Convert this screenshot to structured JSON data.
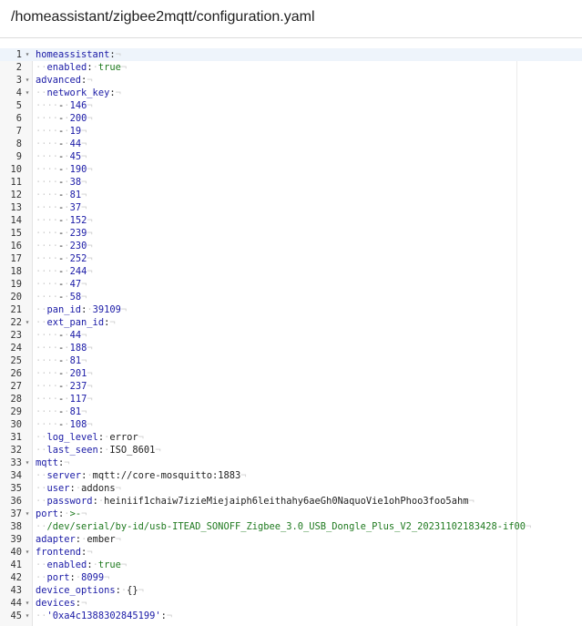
{
  "header": {
    "path": "/homeassistant/zigbee2mqtt/configuration.yaml"
  },
  "editor": {
    "lines": [
      {
        "n": "1",
        "fold": true,
        "indent": "",
        "dash": false,
        "key": "homeassistant",
        "colon": ":",
        "value": "",
        "vtype": "v"
      },
      {
        "n": "2",
        "fold": false,
        "indent": "··",
        "dash": false,
        "key": "enabled",
        "colon": ":",
        "value": "true",
        "vtype": "n"
      },
      {
        "n": "3",
        "fold": true,
        "indent": "",
        "dash": false,
        "key": "advanced",
        "colon": ":",
        "value": "",
        "vtype": "v"
      },
      {
        "n": "4",
        "fold": true,
        "indent": "··",
        "dash": false,
        "key": "network_key",
        "colon": ":",
        "value": "",
        "vtype": "v"
      },
      {
        "n": "5",
        "fold": false,
        "indent": "····",
        "dash": true,
        "key": "",
        "colon": "",
        "value": "146",
        "vtype": "d"
      },
      {
        "n": "6",
        "fold": false,
        "indent": "····",
        "dash": true,
        "key": "",
        "colon": "",
        "value": "200",
        "vtype": "d"
      },
      {
        "n": "7",
        "fold": false,
        "indent": "····",
        "dash": true,
        "key": "",
        "colon": "",
        "value": "19",
        "vtype": "d"
      },
      {
        "n": "8",
        "fold": false,
        "indent": "····",
        "dash": true,
        "key": "",
        "colon": "",
        "value": "44",
        "vtype": "d"
      },
      {
        "n": "9",
        "fold": false,
        "indent": "····",
        "dash": true,
        "key": "",
        "colon": "",
        "value": "45",
        "vtype": "d"
      },
      {
        "n": "10",
        "fold": false,
        "indent": "····",
        "dash": true,
        "key": "",
        "colon": "",
        "value": "190",
        "vtype": "d"
      },
      {
        "n": "11",
        "fold": false,
        "indent": "····",
        "dash": true,
        "key": "",
        "colon": "",
        "value": "38",
        "vtype": "d"
      },
      {
        "n": "12",
        "fold": false,
        "indent": "····",
        "dash": true,
        "key": "",
        "colon": "",
        "value": "81",
        "vtype": "d"
      },
      {
        "n": "13",
        "fold": false,
        "indent": "····",
        "dash": true,
        "key": "",
        "colon": "",
        "value": "37",
        "vtype": "d"
      },
      {
        "n": "14",
        "fold": false,
        "indent": "····",
        "dash": true,
        "key": "",
        "colon": "",
        "value": "152",
        "vtype": "d"
      },
      {
        "n": "15",
        "fold": false,
        "indent": "····",
        "dash": true,
        "key": "",
        "colon": "",
        "value": "239",
        "vtype": "d"
      },
      {
        "n": "16",
        "fold": false,
        "indent": "····",
        "dash": true,
        "key": "",
        "colon": "",
        "value": "230",
        "vtype": "d"
      },
      {
        "n": "17",
        "fold": false,
        "indent": "····",
        "dash": true,
        "key": "",
        "colon": "",
        "value": "252",
        "vtype": "d"
      },
      {
        "n": "18",
        "fold": false,
        "indent": "····",
        "dash": true,
        "key": "",
        "colon": "",
        "value": "244",
        "vtype": "d"
      },
      {
        "n": "19",
        "fold": false,
        "indent": "····",
        "dash": true,
        "key": "",
        "colon": "",
        "value": "47",
        "vtype": "d"
      },
      {
        "n": "20",
        "fold": false,
        "indent": "····",
        "dash": true,
        "key": "",
        "colon": "",
        "value": "58",
        "vtype": "d"
      },
      {
        "n": "21",
        "fold": false,
        "indent": "··",
        "dash": false,
        "key": "pan_id",
        "colon": ":",
        "value": "39109",
        "vtype": "d"
      },
      {
        "n": "22",
        "fold": true,
        "indent": "··",
        "dash": false,
        "key": "ext_pan_id",
        "colon": ":",
        "value": "",
        "vtype": "v"
      },
      {
        "n": "23",
        "fold": false,
        "indent": "····",
        "dash": true,
        "key": "",
        "colon": "",
        "value": "44",
        "vtype": "d"
      },
      {
        "n": "24",
        "fold": false,
        "indent": "····",
        "dash": true,
        "key": "",
        "colon": "",
        "value": "188",
        "vtype": "d"
      },
      {
        "n": "25",
        "fold": false,
        "indent": "····",
        "dash": true,
        "key": "",
        "colon": "",
        "value": "81",
        "vtype": "d"
      },
      {
        "n": "26",
        "fold": false,
        "indent": "····",
        "dash": true,
        "key": "",
        "colon": "",
        "value": "201",
        "vtype": "d"
      },
      {
        "n": "27",
        "fold": false,
        "indent": "····",
        "dash": true,
        "key": "",
        "colon": "",
        "value": "237",
        "vtype": "d"
      },
      {
        "n": "28",
        "fold": false,
        "indent": "····",
        "dash": true,
        "key": "",
        "colon": "",
        "value": "117",
        "vtype": "d"
      },
      {
        "n": "29",
        "fold": false,
        "indent": "····",
        "dash": true,
        "key": "",
        "colon": "",
        "value": "81",
        "vtype": "d"
      },
      {
        "n": "30",
        "fold": false,
        "indent": "····",
        "dash": true,
        "key": "",
        "colon": "",
        "value": "108",
        "vtype": "d"
      },
      {
        "n": "31",
        "fold": false,
        "indent": "··",
        "dash": false,
        "key": "log_level",
        "colon": ":",
        "value": "error",
        "vtype": "v"
      },
      {
        "n": "32",
        "fold": false,
        "indent": "··",
        "dash": false,
        "key": "last_seen",
        "colon": ":",
        "value": "ISO_8601",
        "vtype": "v"
      },
      {
        "n": "33",
        "fold": true,
        "indent": "",
        "dash": false,
        "key": "mqtt",
        "colon": ":",
        "value": "",
        "vtype": "v"
      },
      {
        "n": "34",
        "fold": false,
        "indent": "··",
        "dash": false,
        "key": "server",
        "colon": ":",
        "value": "mqtt://core-mosquitto:1883",
        "vtype": "v"
      },
      {
        "n": "35",
        "fold": false,
        "indent": "··",
        "dash": false,
        "key": "user",
        "colon": ":",
        "value": "addons",
        "vtype": "v"
      },
      {
        "n": "36",
        "fold": false,
        "indent": "··",
        "dash": false,
        "key": "password",
        "colon": ":",
        "value": "heiniif1chaiw7izieMiejaiph6leithahy6aeGh0NaquoVie1ohPhoo3foo5ahm",
        "vtype": "v"
      },
      {
        "n": "37",
        "fold": true,
        "indent": "",
        "dash": false,
        "key": "port",
        "colon": ":",
        "value": ">-",
        "vtype": "n"
      },
      {
        "n": "38",
        "fold": false,
        "indent": "··",
        "dash": false,
        "key": "",
        "colon": "",
        "value": "/dev/serial/by-id/usb-ITEAD_SONOFF_Zigbee_3.0_USB_Dongle_Plus_V2_20231102183428-if00",
        "vtype": "n"
      },
      {
        "n": "39",
        "fold": false,
        "indent": "",
        "dash": false,
        "key": "adapter",
        "colon": ":",
        "value": "ember",
        "vtype": "v"
      },
      {
        "n": "40",
        "fold": true,
        "indent": "",
        "dash": false,
        "key": "frontend",
        "colon": ":",
        "value": "",
        "vtype": "v"
      },
      {
        "n": "41",
        "fold": false,
        "indent": "··",
        "dash": false,
        "key": "enabled",
        "colon": ":",
        "value": "true",
        "vtype": "n"
      },
      {
        "n": "42",
        "fold": false,
        "indent": "··",
        "dash": false,
        "key": "port",
        "colon": ":",
        "value": "8099",
        "vtype": "d"
      },
      {
        "n": "43",
        "fold": false,
        "indent": "",
        "dash": false,
        "key": "device_options",
        "colon": ":",
        "value": "{}",
        "vtype": "v"
      },
      {
        "n": "44",
        "fold": true,
        "indent": "",
        "dash": false,
        "key": "devices",
        "colon": ":",
        "value": "",
        "vtype": "v"
      },
      {
        "n": "45",
        "fold": true,
        "indent": "··",
        "dash": false,
        "key": "'0xa4c1388302845199'",
        "colon": ":",
        "value": "",
        "vtype": "n"
      }
    ]
  }
}
